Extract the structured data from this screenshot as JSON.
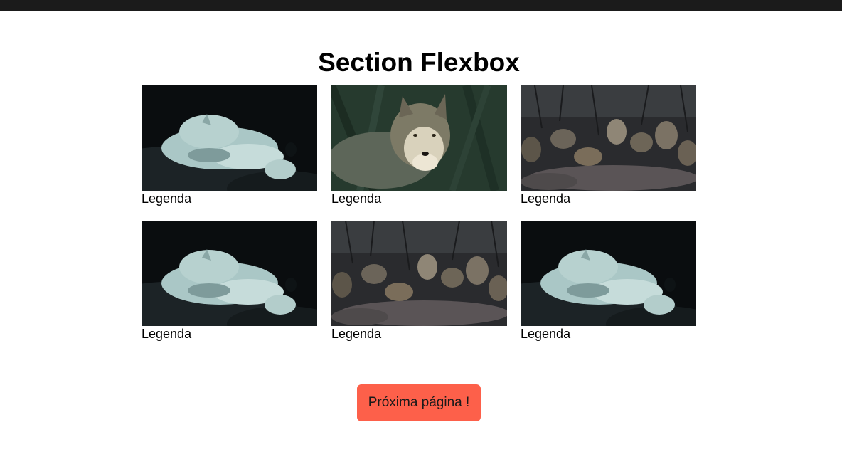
{
  "page": {
    "title": "Section Flexbox"
  },
  "gallery": {
    "items": [
      {
        "caption": "Legenda",
        "image": "white-wolf-sleeping"
      },
      {
        "caption": "Legenda",
        "image": "grey-wolf-portrait"
      },
      {
        "caption": "Legenda",
        "image": "wolf-pack-rocks"
      },
      {
        "caption": "Legenda",
        "image": "white-wolf-sleeping"
      },
      {
        "caption": "Legenda",
        "image": "wolf-pack-rocks"
      },
      {
        "caption": "Legenda",
        "image": "white-wolf-sleeping"
      }
    ]
  },
  "actions": {
    "next_label": "Próxima página !"
  },
  "colors": {
    "topbar": "#1b1b1b",
    "button": "#fd604a"
  }
}
